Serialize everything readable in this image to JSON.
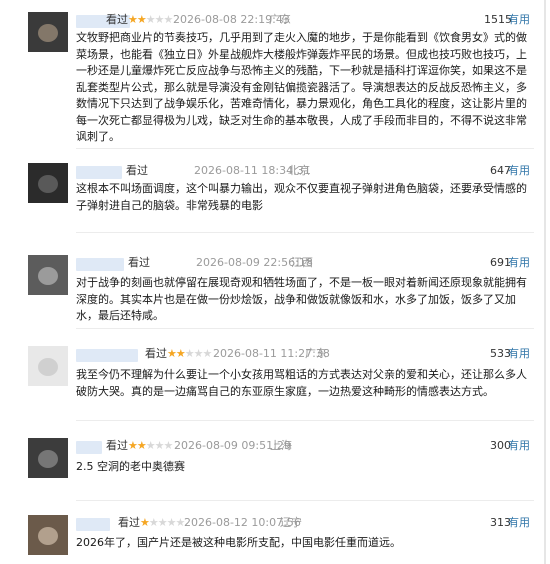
{
  "reviews": [
    {
      "watched": "看过",
      "stars": 2,
      "date": "2026-08-08 22:19:43",
      "location": "广东",
      "count": "1515",
      "useful": "有用",
      "text": "文牧野把商业片的节奏技巧，几乎用到了走火入魔的地步，于是你能看到《饮食男女》式的做菜场景，也能看《独立日》外星战舰炸大楼般炸弹轰炸平民的场景。但成也技巧败也技巧，上一秒还是儿童爆炸死亡反应战争与恐怖主义的残酷，下一秒就是插科打诨逗你笑，如果这不是乱套类型片公式，那么就是导演没有金刚钻偏揽瓷器活了。导演想表达的反战反恐怖主义，多数情况下只达到了战争娱乐化，苦难奇情化，暴力景观化，角色工具化的程度，这让影片里的每一次死亡都显得极为儿戏，缺乏对生命的基本敬畏，人成了手段而非目的，不得不说这非常讽刺了。",
      "colors": [
        "#3a3a3a",
        "#9c8c7a"
      ]
    },
    {
      "watched": "看过",
      "stars": 0,
      "date": "2026-08-11 18:34:31",
      "location": "北京",
      "count": "647",
      "useful": "有用",
      "text": "这根本不叫场面调度，这个叫暴力输出，观众不仅要直视子弹射进角色脑袋，还要承受情感的子弹射进自己的脑袋。非常残暴的电影",
      "colors": [
        "#2b2b2b",
        "#6a6a6a"
      ]
    },
    {
      "watched": "看过",
      "stars": 0,
      "date": "2026-08-09 22:56:18",
      "location": "江西",
      "count": "691",
      "useful": "有用",
      "text": "对于战争的刻画也就停留在展现奇观和牺牲场面了，不是一板一眼对着新闻还原现象就能拥有深度的。其实本片也是在做一份炒烩饭，战争和做饭就像饭和水，水多了加饭，饭多了又加水，最后还特咸。",
      "colors": [
        "#5c5c5c",
        "#b0b0b0"
      ]
    },
    {
      "watched": "看过",
      "stars": 2,
      "date": "2026-08-11 11:27:38",
      "location": "广东",
      "count": "533",
      "useful": "有用",
      "text": "我至今仍不理解为什么要让一个小女孩用骂粗话的方式表达对父亲的爱和关心，还让那么多人破防大哭。真的是一边痛骂自己的东亚原生家庭，一边热爱这种畸形的情感表达方式。",
      "colors": [
        "#e8e8e8",
        "#c8c8c8"
      ]
    },
    {
      "watched": "看过",
      "stars": 2,
      "date": "2026-08-09 09:51:29",
      "location": "上海",
      "count": "300",
      "useful": "有用",
      "text": "2.5 空洞的老中奥德赛",
      "colors": [
        "#3c3c3c",
        "#8a8a8a"
      ]
    },
    {
      "watched": "看过",
      "stars": 1,
      "date": "2026-08-12 10:07:56",
      "location": "辽宁",
      "count": "313",
      "useful": "有用",
      "text": "2026年了，国产片还是被这种电影所支配，中国电影任重而道远。",
      "colors": [
        "#6b5a4a",
        "#c9b8a4"
      ]
    }
  ]
}
